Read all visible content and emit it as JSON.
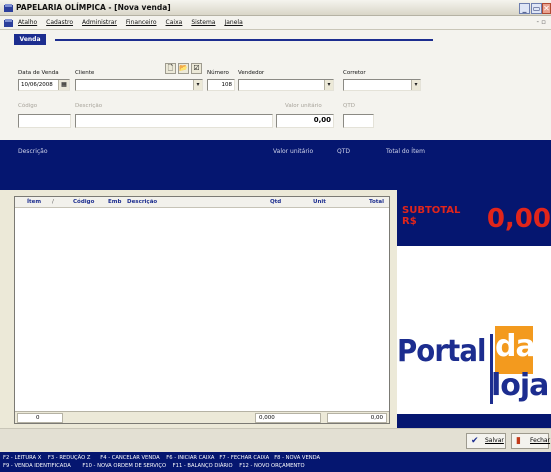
{
  "window": {
    "title": "PAPELARIA OLÍMPICA - [Nova venda]",
    "buttons": {
      "minimize": "_",
      "restore": "▭",
      "close": "✕"
    }
  },
  "menu": {
    "items": [
      "Atalho",
      "Cadastro",
      "Administrar",
      "Financeiro",
      "Caixa",
      "Sistema",
      "Janela"
    ],
    "mdi_controls": "- ▫"
  },
  "form": {
    "tab": "Venda",
    "data_venda_label": "Data de Venda",
    "data_venda_value": "10/06/2008",
    "cliente_label": "Cliente",
    "cliente_value": "",
    "numero_label": "Número",
    "numero_value": "108",
    "vendedor_label": "Vendedor",
    "vendedor_value": "",
    "corretor_label": "Corretor",
    "corretor_value": "",
    "codigo_label": "Código",
    "descricao_label": "Descrição",
    "valor_unitario_label": "Valor unitário",
    "valor_unitario_value": "0,00",
    "qtd_label": "QTD"
  },
  "panel": {
    "descricao": "Descrição",
    "valor_unitario": "Valor unitário",
    "qtd": "QTD",
    "total_item": "Total do Ítem"
  },
  "grid": {
    "columns": [
      "Ítem",
      "/",
      "Código",
      "Emb",
      "Descrição",
      "Qtd",
      "Unit",
      "Total"
    ],
    "rows": [],
    "footer": {
      "count": "0",
      "qtd_total": "0,000",
      "total": "0,00"
    }
  },
  "subtotal": {
    "label_line1": "SUBTOTAL",
    "label_line2": "R$",
    "value": "0,00"
  },
  "logo": {
    "word1": "Portal",
    "word2": "da",
    "word3": "loja"
  },
  "actions": {
    "salvar": "Salvar",
    "fechar": "Fechar"
  },
  "shortcuts": {
    "line1": [
      "F2 - LEITURA X",
      "F3 - REDUÇÃO Z",
      "F4 - CANCELAR VENDA",
      "F6 - INICIAR CAIXA",
      "F7 - FECHAR CAIXA",
      "F8 - NOVA VENDA"
    ],
    "line2": [
      "F9 - VENDA IDENTIFICADA",
      "F10 - NOVA ORDEM DE SERVIÇO",
      "F11 - BALANÇO DIÁRIO",
      "F12 - NOVO ORÇAMENTO"
    ]
  },
  "colors": {
    "navy": "#051670",
    "accent_blue": "#1c2d8f",
    "subtotal_red": "#e1251b",
    "logo_orange": "#f39a1e"
  }
}
